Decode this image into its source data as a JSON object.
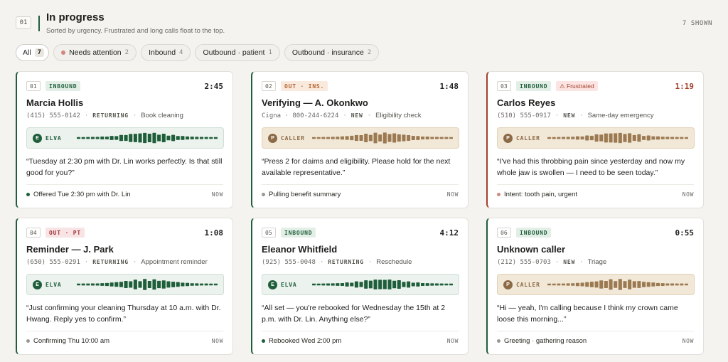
{
  "header": {
    "section_number": "01",
    "title": "In progress",
    "subtitle": "Sorted by urgency. Frustrated and long calls float to the top.",
    "shown": "7 SHOWN"
  },
  "filters": [
    {
      "label": "All",
      "count": "7"
    },
    {
      "label": "Needs attention",
      "count": "2"
    },
    {
      "label": "Inbound",
      "count": "4"
    },
    {
      "label": "Outbound · patient",
      "count": "1"
    },
    {
      "label": "Outbound · insurance",
      "count": "2"
    }
  ],
  "colors": {
    "accent": "#1f5e3b",
    "warn": "#a2402d",
    "caller": "#9b7a52"
  },
  "cards": [
    {
      "index": "01",
      "tag": "INBOUND",
      "timer": "2:45",
      "name": "Marcia Hollis",
      "phone": "(415) 555-0142",
      "status": "RETURNING",
      "reason": "Book cleaning",
      "speaker_badge": "E",
      "speaker": "ELVA",
      "quote": "“Tuesday at 2:30 pm with Dr. Lin works perfectly. Is that still good for you?”",
      "footer": "Offered Tue 2:30 pm with Dr. Lin",
      "now": "NOW"
    },
    {
      "index": "02",
      "tag": "OUT · INS.",
      "timer": "1:48",
      "name": "Verifying — A. Okonkwo",
      "phone": "Cigna · 800-244-6224",
      "status": "NEW",
      "reason": "Eligibility check",
      "speaker_badge": "P",
      "speaker": "CALLER",
      "quote": "“Press 2 for claims and eligibility. Please hold for the next available representative.”",
      "footer": "Pulling benefit summary",
      "now": "NOW"
    },
    {
      "index": "03",
      "tag": "INBOUND",
      "flag": "⚠ Frustrated",
      "timer": "1:19",
      "name": "Carlos Reyes",
      "phone": "(510) 555-0917",
      "status": "NEW",
      "reason": "Same-day emergency",
      "speaker_badge": "P",
      "speaker": "CALLER",
      "quote": "“I've had this throbbing pain since yesterday and now my whole jaw is swollen — I need to be seen today.”",
      "footer": "Intent: tooth pain, urgent",
      "now": "NOW"
    },
    {
      "index": "04",
      "tag": "OUT · PT",
      "timer": "1:08",
      "name": "Reminder — J. Park",
      "phone": "(650) 555-0291",
      "status": "RETURNING",
      "reason": "Appointment reminder",
      "speaker_badge": "E",
      "speaker": "ELVA",
      "quote": "“Just confirming your cleaning Thursday at 10 a.m. with Dr. Hwang. Reply yes to confirm.”",
      "footer": "Confirming Thu 10:00 am",
      "now": "NOW"
    },
    {
      "index": "05",
      "tag": "INBOUND",
      "timer": "4:12",
      "name": "Eleanor Whitfield",
      "phone": "(925) 555-0048",
      "status": "RETURNING",
      "reason": "Reschedule",
      "speaker_badge": "E",
      "speaker": "ELVA",
      "quote": "“All set — you're rebooked for Wednesday the 15th at 2 p.m. with Dr. Lin. Anything else?”",
      "footer": "Rebooked Wed 2:00 pm",
      "now": "NOW"
    },
    {
      "index": "06",
      "tag": "INBOUND",
      "timer": "0:55",
      "name": "Unknown caller",
      "phone": "(212) 555-0703",
      "status": "NEW",
      "reason": "Triage",
      "speaker_badge": "P",
      "speaker": "CALLER",
      "quote": "“Hi — yeah, I'm calling because I think my crown came loose this morning...”",
      "footer": "Greeting · gathering reason",
      "now": "NOW"
    }
  ]
}
